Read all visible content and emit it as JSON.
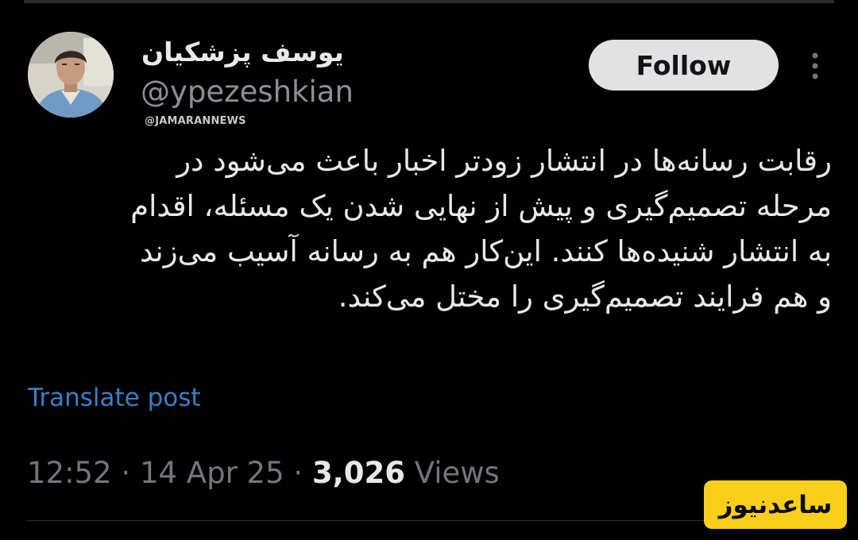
{
  "author": {
    "display_name": "یوسف پزشکیان",
    "handle": "@ypezeshkian",
    "avatar_icon": "person-portrait-icon"
  },
  "source_watermark": "@JAMARANNEWS",
  "follow_label": "Follow",
  "more_icon": "more-vertical-icon",
  "tweet": {
    "lines": [
      "رقابت رسانه‌ها در انتشار زودتر اخبار باعث می‌شود در",
      "مرحله تصمیم‌گیری و پیش از نهایی شدن یک مسئله، اقدام",
      "به انتشار  شنیده‌ها کنند. این‌کار هم به رسانه آسیب می‌زند",
      "و هم فرایند تصمیم‌گیری را مختل می‌کند."
    ]
  },
  "translate_label": "Translate post",
  "meta": {
    "time": "12:52",
    "separator": "·",
    "date": "14 Apr 25",
    "views_count": "3,026",
    "views_label": "Views"
  },
  "badge": {
    "text": "ساعدنیوز",
    "color": "#f9cf1c"
  },
  "colors": {
    "background": "#000000",
    "text_primary": "#e7e9ea",
    "text_secondary": "#71767b",
    "link": "#3a7fc6",
    "follow_bg": "#e2e2e2"
  }
}
